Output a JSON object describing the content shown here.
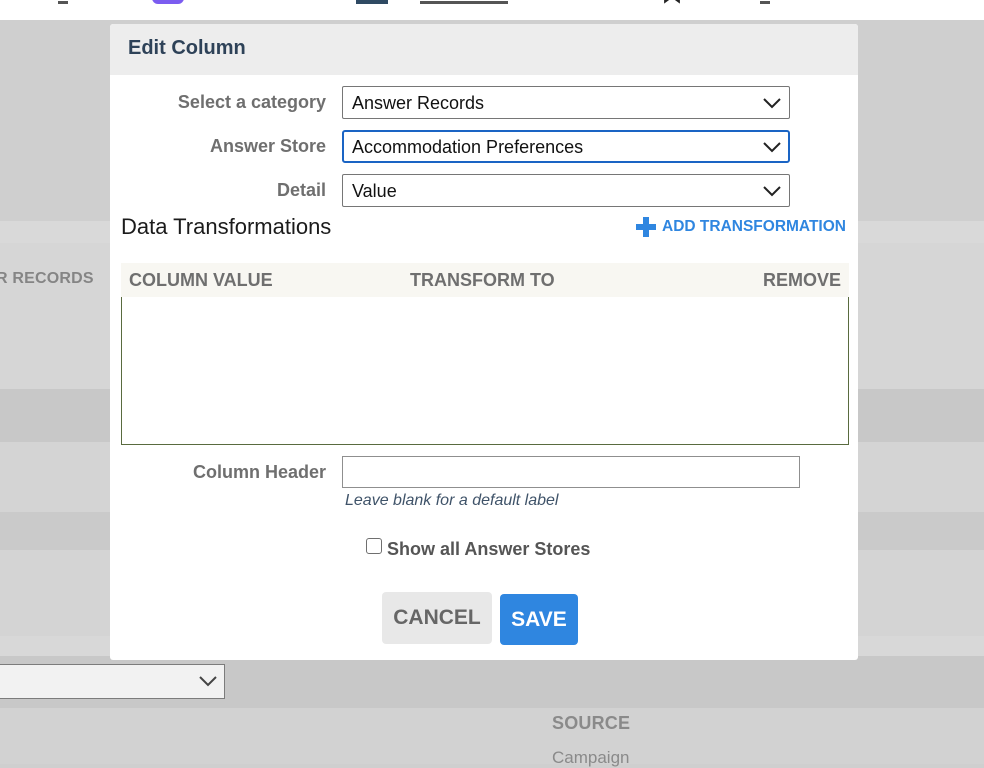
{
  "background": {
    "records_label": "R RECORDS",
    "source_header": "SOURCE",
    "campaign_text": "Campaign"
  },
  "modal": {
    "title": "Edit Column",
    "fields": {
      "category": {
        "label": "Select a category",
        "value": "Answer Records"
      },
      "answer_store": {
        "label": "Answer Store",
        "value": "Accommodation Preferences"
      },
      "detail": {
        "label": "Detail",
        "value": "Value"
      }
    },
    "transformations": {
      "title": "Data Transformations",
      "add_label": "ADD TRANSFORMATION",
      "columns": [
        "COLUMN VALUE",
        "TRANSFORM TO",
        "REMOVE"
      ],
      "rows": []
    },
    "column_header": {
      "label": "Column Header",
      "value": "",
      "hint": "Leave blank for a default label"
    },
    "show_all_answer_stores": {
      "label": "Show all Answer Stores",
      "checked": false
    },
    "buttons": {
      "cancel": "CANCEL",
      "save": "SAVE"
    }
  },
  "colors": {
    "accent": "#2f86e0",
    "title": "#2e4258",
    "focus_border": "#1a64c4"
  }
}
